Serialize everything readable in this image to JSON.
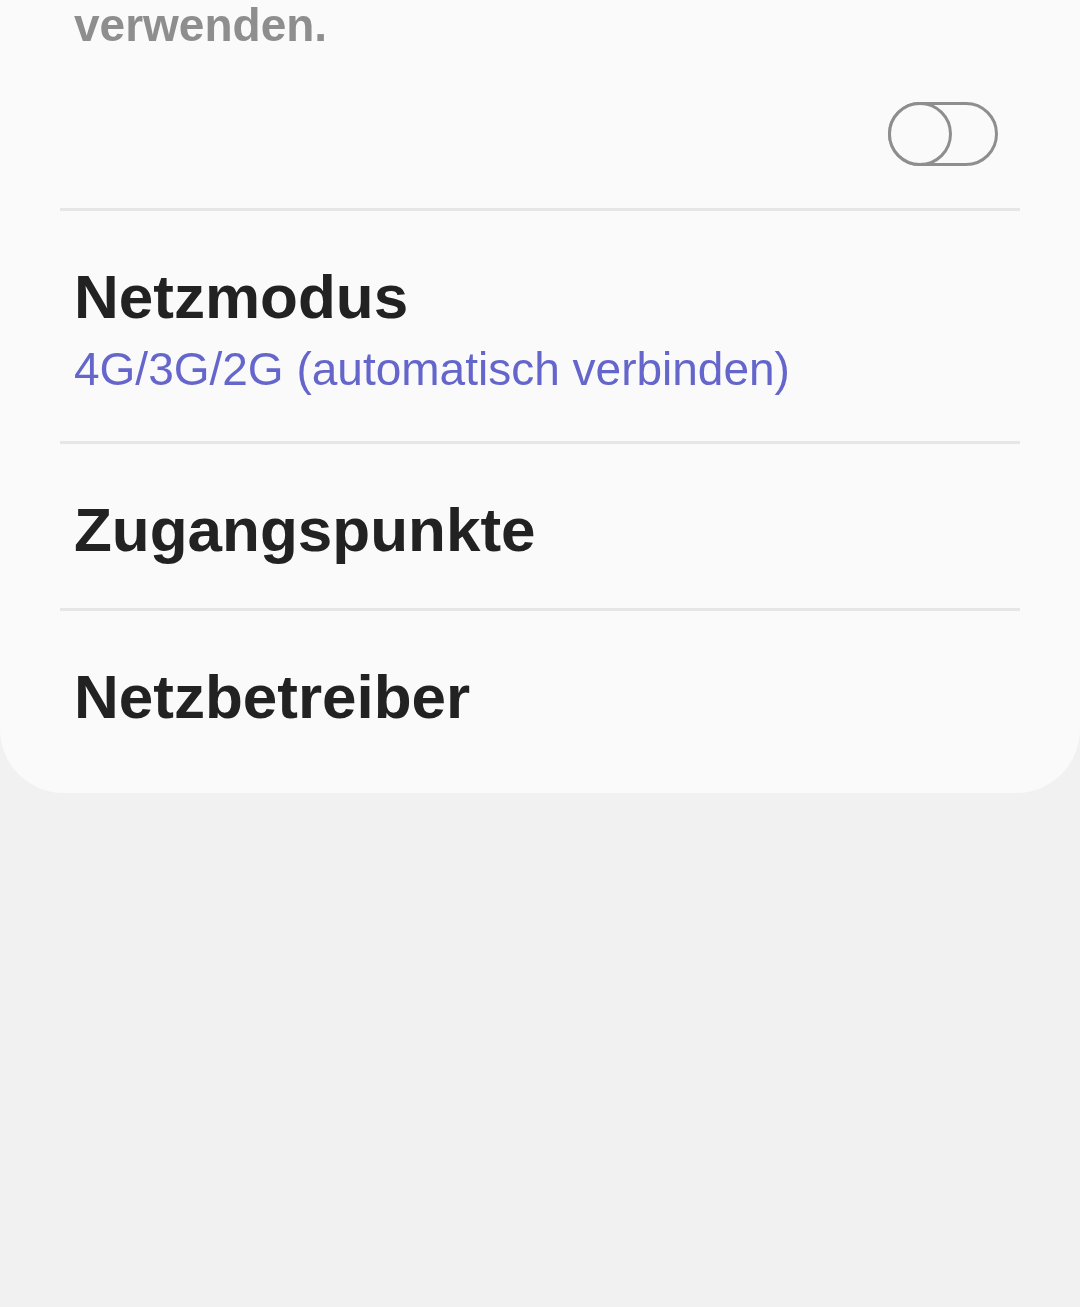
{
  "description_tail": "verwenden.",
  "toggle": {
    "on": false
  },
  "items": [
    {
      "title": "Netzmodus",
      "summary": "4G/3G/2G (automatisch verbinden)"
    },
    {
      "title": "Zugangspunkte"
    },
    {
      "title": "Netzbetreiber"
    }
  ]
}
